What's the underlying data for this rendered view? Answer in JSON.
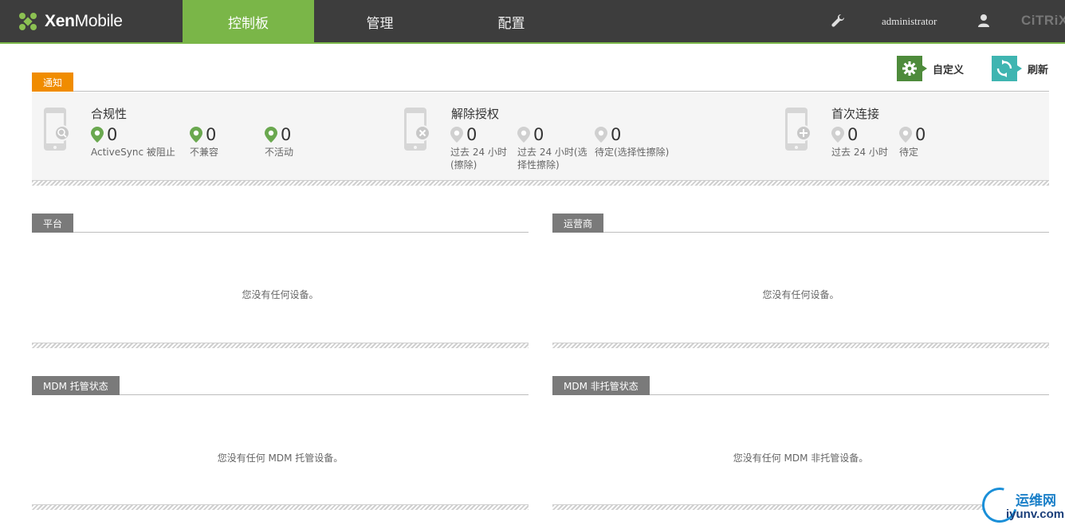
{
  "header": {
    "brand_bold": "Xen",
    "brand_light": "Mobile",
    "tabs": [
      {
        "label": "控制板",
        "active": true
      },
      {
        "label": "管理",
        "active": false
      },
      {
        "label": "配置",
        "active": false
      }
    ],
    "user": "administrator",
    "vendor": "CiTRiX"
  },
  "actions": {
    "customize_label": "自定义",
    "refresh_label": "刷新"
  },
  "notifications": {
    "tab_label": "通知",
    "groups": [
      {
        "title": "合规性",
        "stats": [
          {
            "value": "0",
            "label": "ActiveSync 被阻止"
          },
          {
            "value": "0",
            "label": "不兼容"
          },
          {
            "value": "0",
            "label": "不活动"
          }
        ]
      },
      {
        "title": "解除授权",
        "stats": [
          {
            "value": "0",
            "label": "过去 24 小时 (擦除)"
          },
          {
            "value": "0",
            "label": "过去 24 小时(选择性擦除)"
          },
          {
            "value": "0",
            "label": "待定(选择性擦除)"
          }
        ]
      },
      {
        "title": "首次连接",
        "stats": [
          {
            "value": "0",
            "label": "过去 24 小时"
          },
          {
            "value": "0",
            "label": "待定"
          }
        ]
      }
    ]
  },
  "panels": {
    "platform": {
      "label": "平台",
      "empty": "您没有任何设备。"
    },
    "carrier": {
      "label": "运营商",
      "empty": "您没有任何设备。"
    },
    "mdm_managed": {
      "label": "MDM 托管状态",
      "empty": "您没有任何 MDM 托管设备。"
    },
    "mdm_unmanaged": {
      "label": "MDM 非托管状态",
      "empty": "您没有任何 MDM 非托管设备。"
    }
  },
  "watermark": {
    "cn": "运维网",
    "en": "iyunv.com"
  },
  "colors": {
    "accent_green": "#7ab648",
    "notify_orange": "#f08c00",
    "topbar": "#3d3d3d",
    "refresh_teal": "#3fb5b1"
  }
}
